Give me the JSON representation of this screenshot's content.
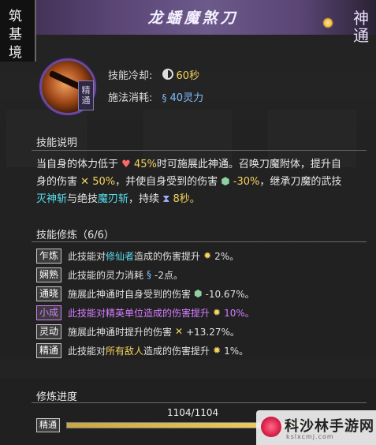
{
  "header": {
    "title": "龙蟠魔煞刀",
    "left_badge": [
      "筑",
      "基",
      "境"
    ],
    "right_badge": [
      "神",
      "通"
    ]
  },
  "skill": {
    "mastery_tag": "精通",
    "cooldown_label": "技能冷却:",
    "cooldown_value": "60秒",
    "cost_label": "施法消耗:",
    "cost_value": "40灵力"
  },
  "description": {
    "title": "技能说明",
    "line1_a": "当自身的体力低于",
    "line1_pct": "45%",
    "line1_b": "时可施展此神通。召唤刀魔附体，提升自",
    "line2_a": "身的伤害",
    "line2_pct": "50%",
    "line2_b": "，并使自身受到的伤害",
    "line2_pct2": "-30%",
    "line2_c": "，继承刀魔的武技",
    "line3_skill1": "灭神斩",
    "line3_and": "与绝技",
    "line3_skill2": "魔刃斩",
    "line3_dur": "，持续",
    "line3_val": "8秒。"
  },
  "cultivation": {
    "title": "技能修炼（6/6）",
    "rows": [
      {
        "tag": "乍炼",
        "pre": "此技能对",
        "hl": "修仙者",
        "post": "造成的伤害提升",
        "val": "2%。"
      },
      {
        "tag": "娴熟",
        "pre": "此技能的灵力消耗",
        "val": "-2点。"
      },
      {
        "tag": "通晓",
        "pre": "施展此神通时自身受到的伤害",
        "val": "-10.67%。"
      },
      {
        "tag": "小成",
        "pre": "此技能对精英单位造成的伤害提升",
        "val": "10%。"
      },
      {
        "tag": "灵动",
        "pre": "施展此神通时提升的伤害",
        "val": "+13.27%。"
      },
      {
        "tag": "精通",
        "pre": "此技能对",
        "hl": "所有敌人",
        "post": "造成的伤害提升",
        "val": "1%。"
      }
    ]
  },
  "progress": {
    "title": "修炼进度",
    "text": "1104/1104",
    "tag": "精通",
    "fraction": 1.0
  },
  "watermark": {
    "text": "科沙林手游网",
    "sub": "kslxcmj.com"
  }
}
